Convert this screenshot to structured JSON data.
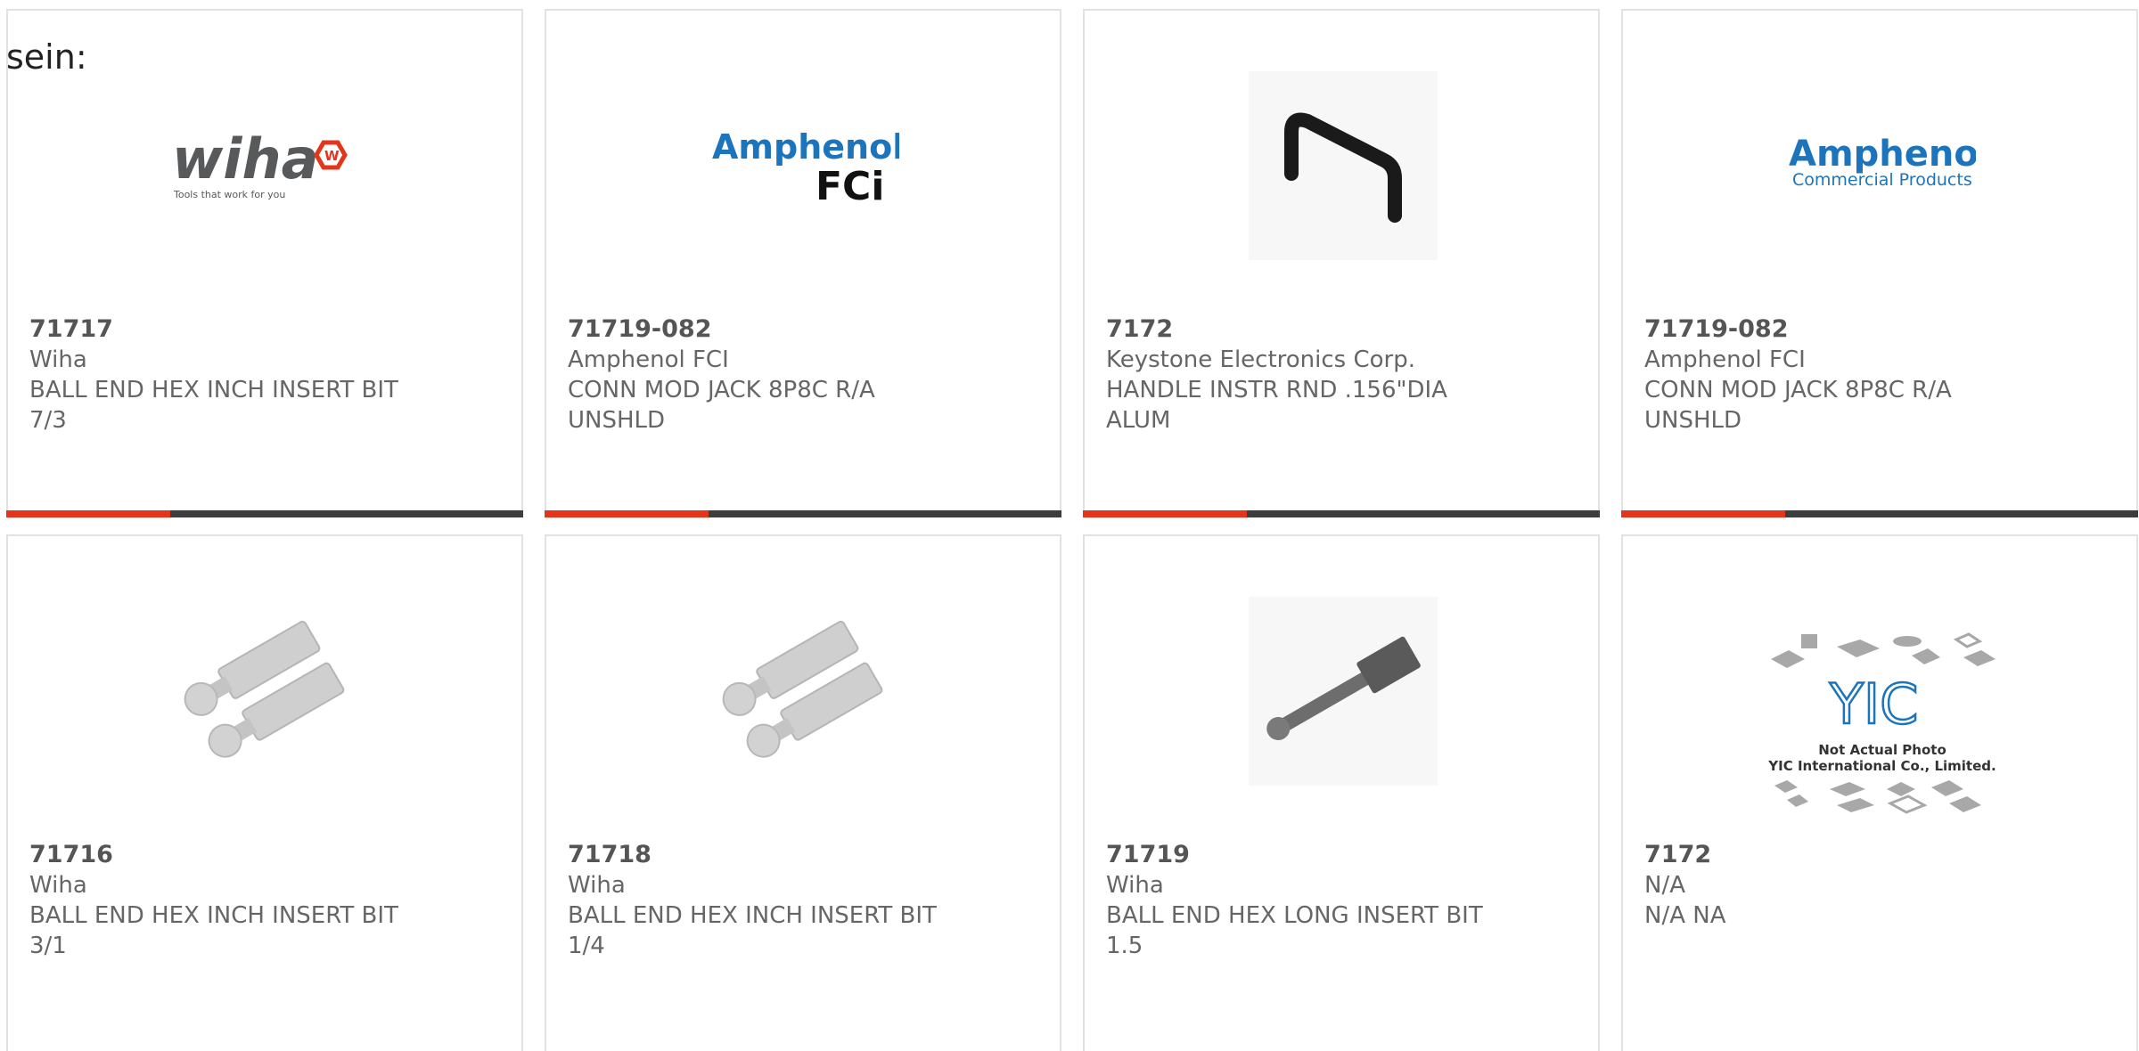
{
  "prefix_text": "sein:",
  "colors": {
    "accent": "#e3341c",
    "bar": "#3d3d3d",
    "border": "#e2e2e2",
    "text": "#666666"
  },
  "cards": [
    {
      "part": "71717",
      "maker": "Wiha",
      "desc1": "BALL END HEX INCH INSERT BIT",
      "desc2": "7/3",
      "image": "wiha-logo"
    },
    {
      "part": "71719-082",
      "maker": "Amphenol FCI",
      "desc1": "CONN MOD JACK 8P8C R/A",
      "desc2": "UNSHLD",
      "image": "amphenol-fci-logo"
    },
    {
      "part": "7172",
      "maker": "Keystone Electronics Corp.",
      "desc1": "HANDLE INSTR RND .156\"DIA",
      "desc2": "ALUM",
      "image": "handle-photo"
    },
    {
      "part": "71719-082",
      "maker": "Amphenol FCI",
      "desc1": "CONN MOD JACK 8P8C R/A",
      "desc2": "UNSHLD",
      "image": "amphenol-commercial-logo"
    },
    {
      "part": "71716",
      "maker": "Wiha",
      "desc1": "BALL END HEX INCH INSERT BIT",
      "desc2": "3/1",
      "image": "insert-bits-photo"
    },
    {
      "part": "71718",
      "maker": "Wiha",
      "desc1": "BALL END HEX INCH INSERT BIT",
      "desc2": "1/4",
      "image": "insert-bits-photo"
    },
    {
      "part": "71719",
      "maker": "Wiha",
      "desc1": "BALL END HEX LONG INSERT BIT",
      "desc2": "1.5",
      "image": "long-bit-photo"
    },
    {
      "part": "7172",
      "maker": "N/A",
      "desc1": "N/A NA",
      "desc2": "",
      "image": "yic-placeholder"
    }
  ],
  "logos": {
    "wiha_word": "wiha",
    "wiha_tagline": "Tools that work for you",
    "amphenol_word": "Amphenol",
    "fci_word": "FCi",
    "commercial_products": "Commercial Products",
    "yic_letters": "YIC",
    "yic_note1": "Not Actual Photo",
    "yic_note2": "YIC International Co., Limited."
  }
}
